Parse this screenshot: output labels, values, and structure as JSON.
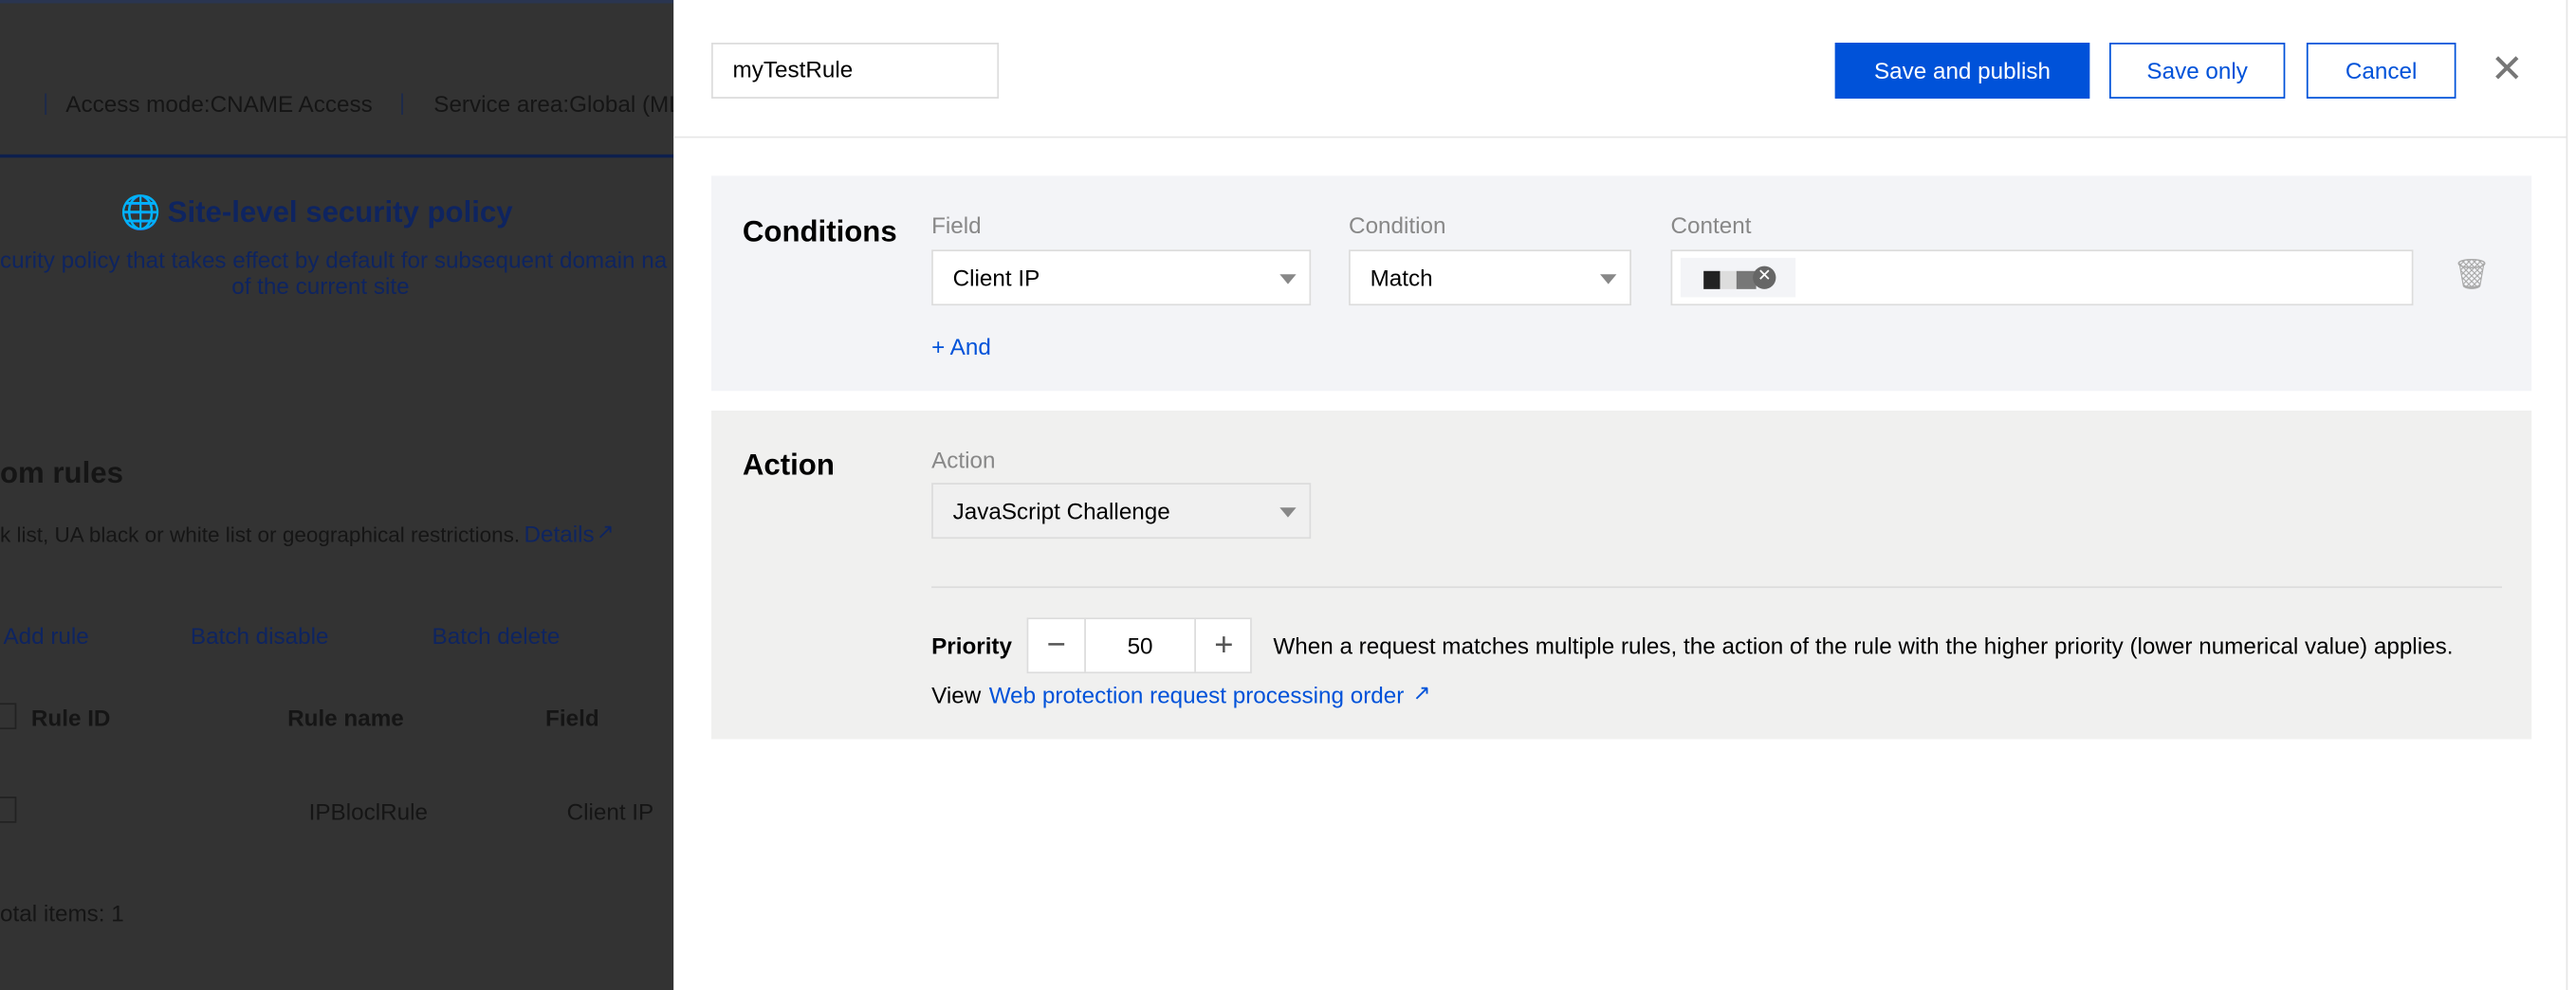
{
  "background": {
    "access_mode": "Access mode:CNAME Access",
    "service_area": "Service area:Global (ML",
    "policy_title": "Site-level security policy",
    "policy_desc_1": "curity policy that takes effect by default for subsequent domain na",
    "policy_desc_2": "of the current site",
    "section_title": "om rules",
    "section_desc": "k list, UA black or white list or geographical restrictions.",
    "details_link": "Details",
    "buttons": [
      "Add rule",
      "Batch disable",
      "Batch delete"
    ],
    "table_headers": [
      "Rule ID",
      "Rule name",
      "Field"
    ],
    "rows": [
      {
        "rule_name": "IPBloclRule",
        "field": "Client IP"
      }
    ],
    "total_items": "otal items:  1"
  },
  "drawer": {
    "rule_name_value": "myTestRule",
    "save_publish_label": "Save and publish",
    "save_only_label": "Save only",
    "cancel_label": "Cancel",
    "conditions": {
      "title": "Conditions",
      "field_label": "Field",
      "condition_label": "Condition",
      "content_label": "Content",
      "field_value": "Client IP",
      "condition_value": "Match",
      "add_and_label": "+ And"
    },
    "action": {
      "title": "Action",
      "action_label": "Action",
      "action_value": "JavaScript Challenge",
      "priority_label": "Priority",
      "priority_value": "50",
      "priority_desc": "When a request matches multiple rules, the action of the rule with the higher priority (lower numerical value) applies.",
      "view_label": "View",
      "order_link": "Web protection request processing order"
    }
  },
  "colors": {
    "accent": "#0052d9",
    "conditions_bg": "#f3f4f7",
    "action_bg": "#f0f0ef",
    "overlay": "#333333"
  }
}
